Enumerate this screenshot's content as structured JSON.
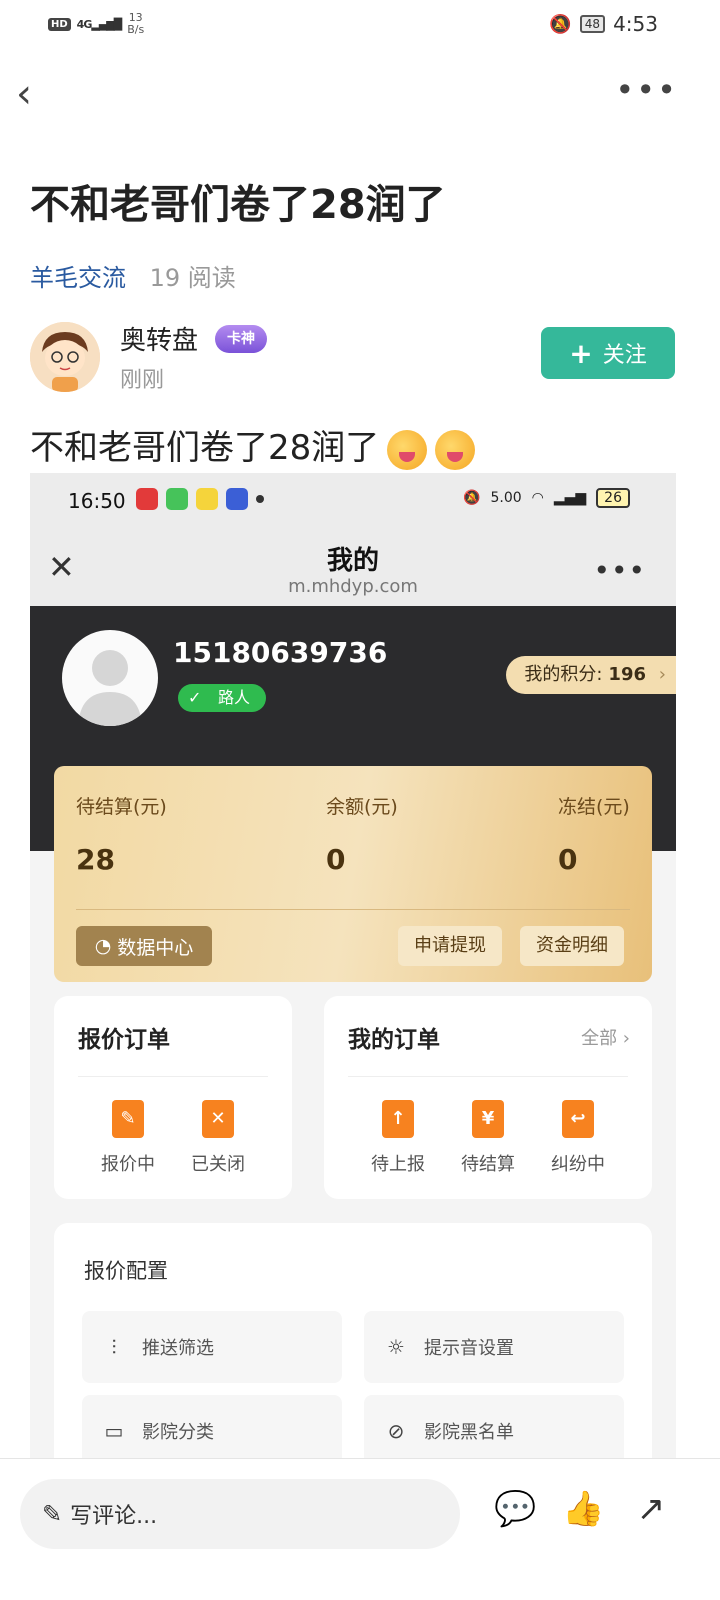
{
  "status_bar": {
    "network": "4G",
    "speed": "13",
    "speed_unit": "B/s",
    "battery": "48",
    "time": "4:53"
  },
  "post": {
    "title": "不和老哥们卷了28润了",
    "category": "羊毛交流",
    "reads": "19 阅读",
    "author": {
      "name": "奥转盘",
      "badge": "卡神",
      "time": "刚刚"
    },
    "follow_label": "关注",
    "body": "不和老哥们卷了28润了"
  },
  "screenshot": {
    "status": {
      "time": "16:50",
      "speed": "5.00",
      "battery": "26"
    },
    "nav": {
      "title": "我的",
      "url": "m.mhdyp.com"
    },
    "user": {
      "phone": "15180639736",
      "level": "路人",
      "points_label": "我的积分:",
      "points_value": "196"
    },
    "balance": {
      "pending_label": "待结算(元)",
      "pending_value": "28",
      "balance_label": "余额(元)",
      "balance_value": "0",
      "frozen_label": "冻结(元)",
      "frozen_value": "0",
      "data_center": "数据中心",
      "withdraw": "申请提现",
      "details": "资金明细"
    },
    "quote_orders": {
      "title": "报价订单",
      "items": [
        "报价中",
        "已关闭"
      ]
    },
    "my_orders": {
      "title": "我的订单",
      "all": "全部",
      "items": [
        "待上报",
        "待结算",
        "纠纷中"
      ]
    },
    "config": {
      "title": "报价配置",
      "items": [
        "推送筛选",
        "提示音设置",
        "影院分类",
        "影院黑名单"
      ]
    }
  },
  "bottom_bar": {
    "comment_placeholder": "写评论..."
  },
  "colors": {
    "accent_green": "#35b89a",
    "link_blue": "#2a5aa0",
    "gold": "#f2d9a3",
    "orange_icon": "#f7821f"
  }
}
